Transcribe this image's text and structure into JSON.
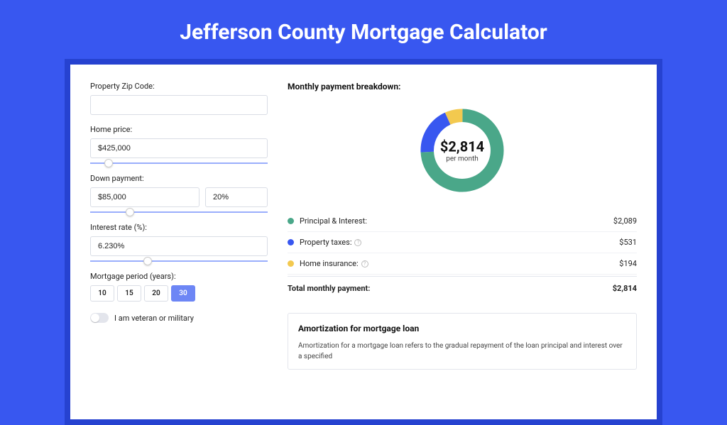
{
  "title": "Jefferson County Mortgage Calculator",
  "form": {
    "zip_label": "Property Zip Code:",
    "zip_value": "",
    "home_price_label": "Home price:",
    "home_price_value": "$425,000",
    "down_payment_label": "Down payment:",
    "down_payment_value": "$85,000",
    "down_payment_pct": "20%",
    "interest_label": "Interest rate (%):",
    "interest_value": "6.230%",
    "period_label": "Mortgage period (years):",
    "periods": [
      "10",
      "15",
      "20",
      "30"
    ],
    "period_selected": "30",
    "veteran_label": "I am veteran or military"
  },
  "breakdown": {
    "title": "Monthly payment breakdown:",
    "donut_amount": "$2,814",
    "donut_sub": "per month",
    "rows": [
      {
        "color": "green",
        "label": "Principal & Interest:",
        "value": "$2,089"
      },
      {
        "color": "blue",
        "label": "Property taxes:",
        "value": "$531"
      },
      {
        "color": "yellow",
        "label": "Home insurance:",
        "value": "$194"
      }
    ],
    "total_label": "Total monthly payment:",
    "total_value": "$2,814"
  },
  "chart_data": {
    "type": "pie",
    "title": "Monthly payment breakdown",
    "series": [
      {
        "name": "Principal & Interest",
        "value": 2089,
        "color": "#4aa789"
      },
      {
        "name": "Property taxes",
        "value": 531,
        "color": "#3857f0"
      },
      {
        "name": "Home insurance",
        "value": 194,
        "color": "#f3c94f"
      }
    ],
    "center_value": "$2,814",
    "center_sub": "per month"
  },
  "amortization": {
    "title": "Amortization for mortgage loan",
    "text": "Amortization for a mortgage loan refers to the gradual repayment of the loan principal and interest over a specified"
  }
}
